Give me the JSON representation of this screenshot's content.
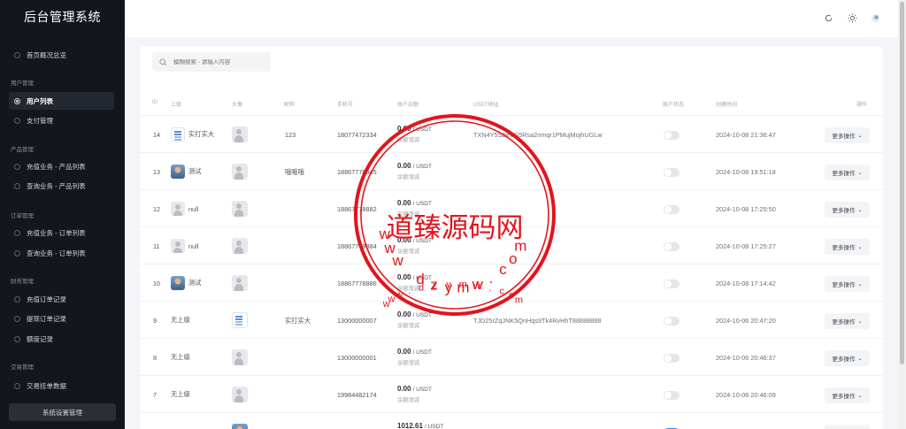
{
  "app": {
    "title": "后台管理系统"
  },
  "sidebar": {
    "items": [
      {
        "label": "首页概况总览",
        "active": false
      },
      {
        "group": "用户管理"
      },
      {
        "label": "用户列表",
        "active": true
      },
      {
        "label": "支付管理",
        "active": false
      },
      {
        "group": "产品管理"
      },
      {
        "label": "充值业务 - 产品列表",
        "active": false
      },
      {
        "label": "查询业务 - 产品列表",
        "active": false
      },
      {
        "group": "订单管理"
      },
      {
        "label": "充值业务 - 订单列表",
        "active": false
      },
      {
        "label": "查询业务 - 订单列表",
        "active": false
      },
      {
        "group": "财务管理"
      },
      {
        "label": "充值订单记录",
        "active": false
      },
      {
        "label": "提现订单记录",
        "active": false
      },
      {
        "label": "额度记录",
        "active": false
      },
      {
        "group": "交易管理"
      },
      {
        "label": "交易挂单数据",
        "active": false
      }
    ],
    "system_button": "系统设置管理"
  },
  "topbar": {
    "icons": [
      "refresh-icon",
      "theme-sun-icon",
      "user-avatar-icon"
    ]
  },
  "search": {
    "placeholder": "模糊搜索 - 请输入内容"
  },
  "table": {
    "headers": {
      "id": "ID",
      "superior": "上级",
      "head": "头像",
      "nickname": "昵称",
      "phone": "手机号",
      "balance": "账户余额",
      "usdt": "USDT地址",
      "status": "账户状态",
      "created": "创建时间",
      "actions": "操作"
    },
    "rows": [
      {
        "id": "14",
        "superior": "实打实大",
        "sup_avatar": "doc",
        "head_avatar": "grey",
        "nickname": "123",
        "phone": "18077472334",
        "balance": "0.00",
        "unit": "/ USDT",
        "sub": "余额增减",
        "usdt": "TXN4Y5SBe6G5Rsa2nmqr1PMujMojhUGLw",
        "status_on": false,
        "created": "2024-10-08 21:36:47",
        "action": "更多操作"
      },
      {
        "id": "13",
        "superior": "测试",
        "sup_avatar": "photo",
        "head_avatar": "grey",
        "nickname": "哦哦哦",
        "phone": "18867778845",
        "balance": "0.00",
        "unit": "/ USDT",
        "sub": "余额增减",
        "usdt": "",
        "status_on": false,
        "created": "2024-10-08 19:51:18",
        "action": "更多操作"
      },
      {
        "id": "12",
        "superior": "null",
        "sup_avatar": "grey",
        "head_avatar": "grey",
        "nickname": "",
        "phone": "18867778882",
        "balance": "0.00",
        "unit": "/ USDT",
        "sub": "余额增减",
        "usdt": "",
        "status_on": false,
        "created": "2024-10-08 17:25:50",
        "action": "更多操作"
      },
      {
        "id": "11",
        "superior": "null",
        "sup_avatar": "grey",
        "head_avatar": "grey",
        "nickname": "",
        "phone": "18867778884",
        "balance": "0.00",
        "unit": "/ USDT",
        "sub": "余额增减",
        "usdt": "",
        "status_on": false,
        "created": "2024-10-08 17:25:27",
        "action": "更多操作"
      },
      {
        "id": "10",
        "superior": "测试",
        "sup_avatar": "photo",
        "head_avatar": "grey",
        "nickname": "",
        "phone": "18867778886",
        "balance": "0.00",
        "unit": "/ USDT",
        "sub": "余额增减",
        "usdt": "",
        "status_on": false,
        "created": "2024-10-08 17:14:42",
        "action": "更多操作"
      },
      {
        "id": "9",
        "superior": "无上级",
        "sup_avatar": "",
        "head_avatar": "doc",
        "nickname": "实打实大",
        "phone": "13000000007",
        "balance": "0.00",
        "unit": "/ USDT",
        "sub": "余额增减",
        "usdt": "TJD25rZqJNK5QnHqs9Tk4RvHhT88888888",
        "status_on": false,
        "created": "2024-10-06 20:47:20",
        "action": "更多操作"
      },
      {
        "id": "8",
        "superior": "无上级",
        "sup_avatar": "",
        "head_avatar": "grey",
        "nickname": "",
        "phone": "13000000001",
        "balance": "0.00",
        "unit": "/ USDT",
        "sub": "余额增减",
        "usdt": "",
        "status_on": false,
        "created": "2024-10-06 20:46:37",
        "action": "更多操作"
      },
      {
        "id": "7",
        "superior": "无上级",
        "sup_avatar": "",
        "head_avatar": "grey",
        "nickname": "",
        "phone": "19984482174",
        "balance": "0.00",
        "unit": "/ USDT",
        "sub": "余额增减",
        "usdt": "",
        "status_on": false,
        "created": "2024-10-06 20:46:09",
        "action": "更多操作"
      },
      {
        "id": "",
        "superior": "",
        "sup_avatar": "",
        "head_avatar": "photo",
        "nickname": "",
        "phone": "",
        "balance": "1012.61",
        "unit": "/ USDT",
        "sub": "",
        "usdt": "",
        "status_on": true,
        "created": "",
        "action": "更多操作"
      }
    ]
  },
  "watermark": {
    "text": "道臻源码网",
    "top_letters": [
      "w",
      "w",
      "w",
      ".",
      "d",
      "z",
      "y",
      "m",
      "w",
      ".",
      "c",
      "o",
      "m"
    ],
    "bottom_letters": [
      "w",
      "w",
      "w",
      ".",
      "d",
      "z",
      "y",
      "m",
      "w",
      ".",
      "c",
      "o",
      "m"
    ],
    "color": "#e3141c"
  }
}
